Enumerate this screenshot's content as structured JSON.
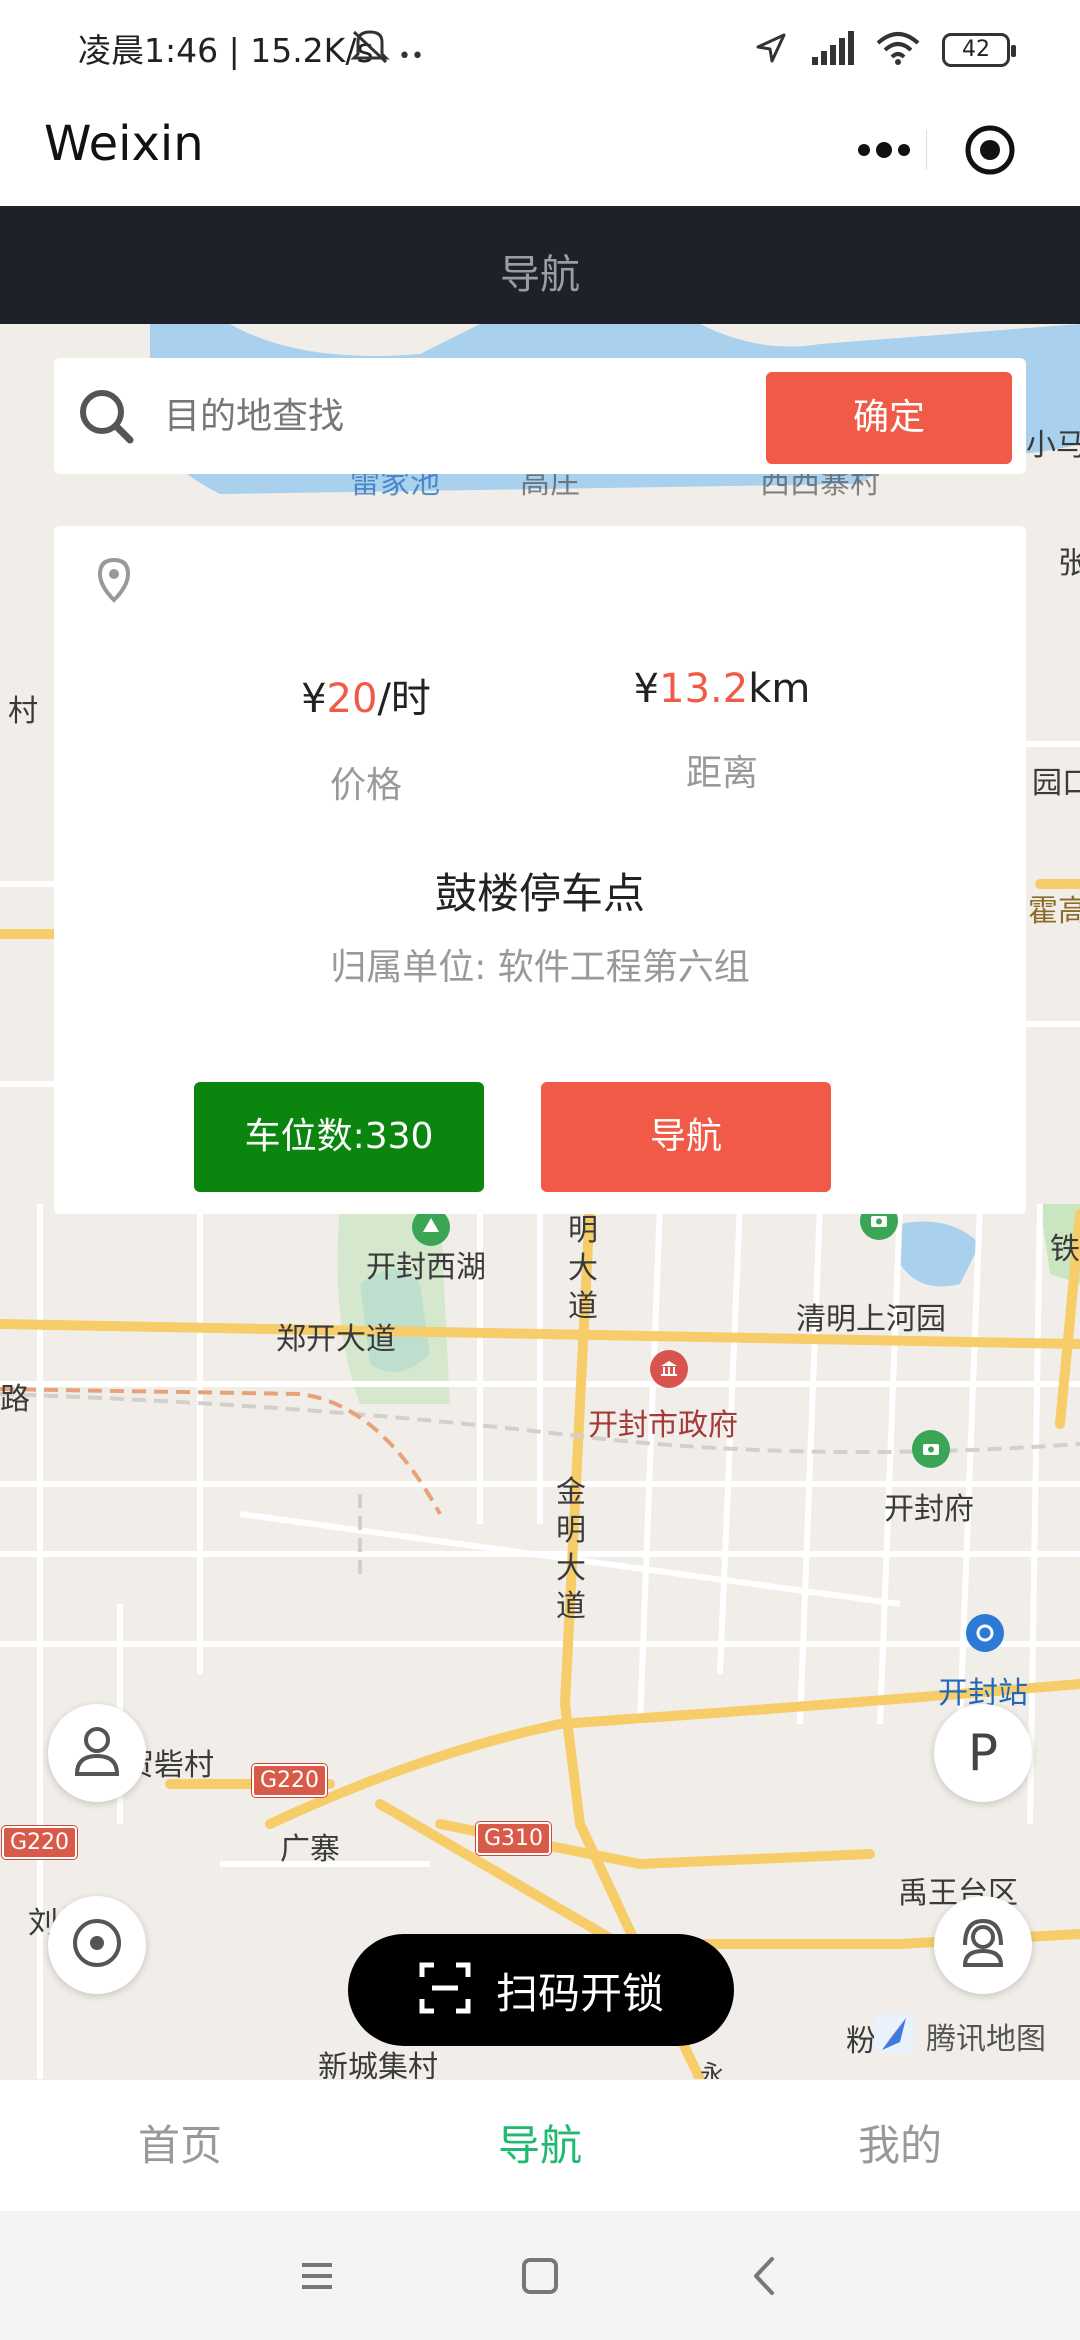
{
  "status_bar": {
    "left_text": "凌晨1:46 | 15.2K/s",
    "battery": "42"
  },
  "weixin": {
    "title": "Weixin",
    "more_icon": "more-dots-icon",
    "close_icon": "target-close-icon"
  },
  "page": {
    "title": "导航"
  },
  "search": {
    "placeholder": "目的地查找",
    "confirm_label": "确定"
  },
  "info_card": {
    "price_currency": "¥",
    "price_value": "20",
    "price_unit": "/时",
    "price_label": "价格",
    "distance_currency": "¥",
    "distance_value": "13.2",
    "distance_unit": "km",
    "distance_label": "距离",
    "lot_name": "鼓楼停车点",
    "owner_text": "归属单位: 软件工程第六组",
    "spots_label": "车位数:330",
    "navigate_label": "导航"
  },
  "map": {
    "labels": {
      "kaifeng_xihu": "开封西湖",
      "zhengkai_road": "郑开大道",
      "ming_road": "明大道",
      "qingming_park": "清明上河园",
      "city_gov": "开封市政府",
      "jinming_road": "金明大道",
      "kaifeng_fu": "开封府",
      "kaifeng_station": "开封站",
      "hezhai": "贺砦村",
      "guangzhai": "广寨",
      "liu_village": "刘村",
      "yuwangtai": "禹王台区",
      "xincheng": "新城集村",
      "xiaoma": "小马",
      "zhang": "张",
      "yuankou": "园口",
      "huogao": "霍高",
      "tie": "铁",
      "cun": "村",
      "lu": "路",
      "fen": "粉",
      "top_left": "雷家池",
      "top_mid": "高庄",
      "top_right": "西西寨村",
      "yong": "永"
    },
    "shields": {
      "g220_a": "G220",
      "g220_b": "G220",
      "g310": "G310"
    },
    "scan_label": "扫码开锁",
    "provider": "腾讯地图",
    "parking_label": "P"
  },
  "tabs": [
    {
      "label": "首页",
      "active": false
    },
    {
      "label": "导航",
      "active": true
    },
    {
      "label": "我的",
      "active": false
    }
  ],
  "colors": {
    "accent_red": "#f05a47",
    "accent_green": "#0a860e",
    "tab_active": "#1fba6f",
    "header_dark": "#1e2127"
  }
}
